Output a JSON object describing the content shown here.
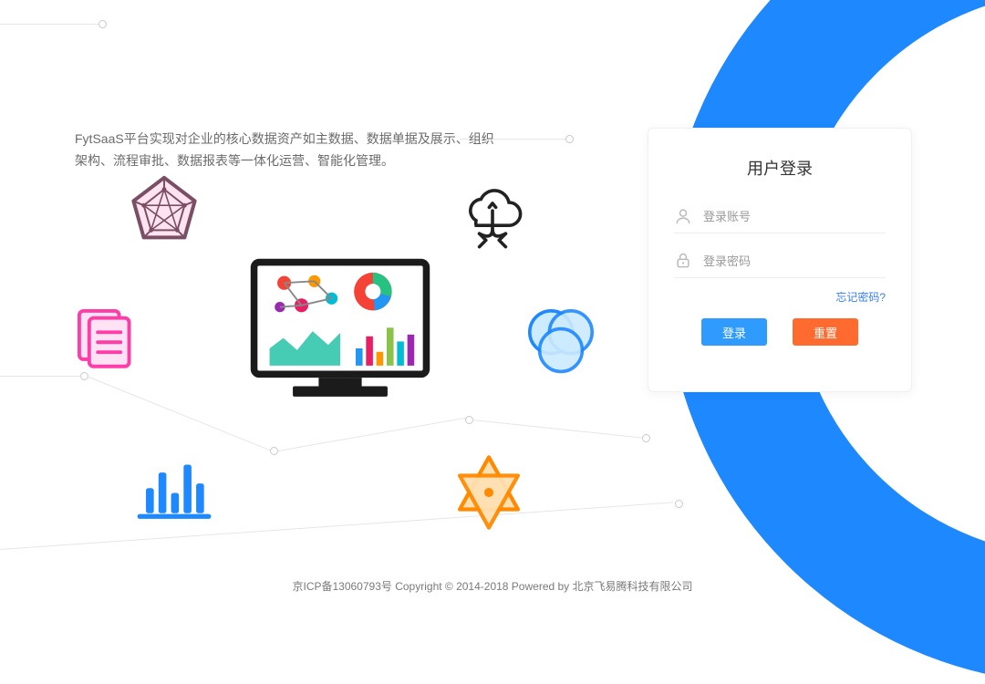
{
  "intro_text": "FytSaaS平台实现对企业的核心数据资产如主数据、数据单据及展示、组织架构、流程审批、数据报表等一体化运营、智能化管理。",
  "login": {
    "title": "用户登录",
    "username_placeholder": "登录账号",
    "password_placeholder": "登录密码",
    "forgot_label": "忘记密码?",
    "login_btn": "登录",
    "reset_btn": "重置"
  },
  "footer_text": "京ICP备13060793号 Copyright © 2014-2018 Powered by 北京飞易腾科技有限公司",
  "colors": {
    "primary_blue": "#1E88FF",
    "btn_blue": "#2F9BFF",
    "btn_orange": "#FF6A2E",
    "link_blue": "#347EFF"
  }
}
